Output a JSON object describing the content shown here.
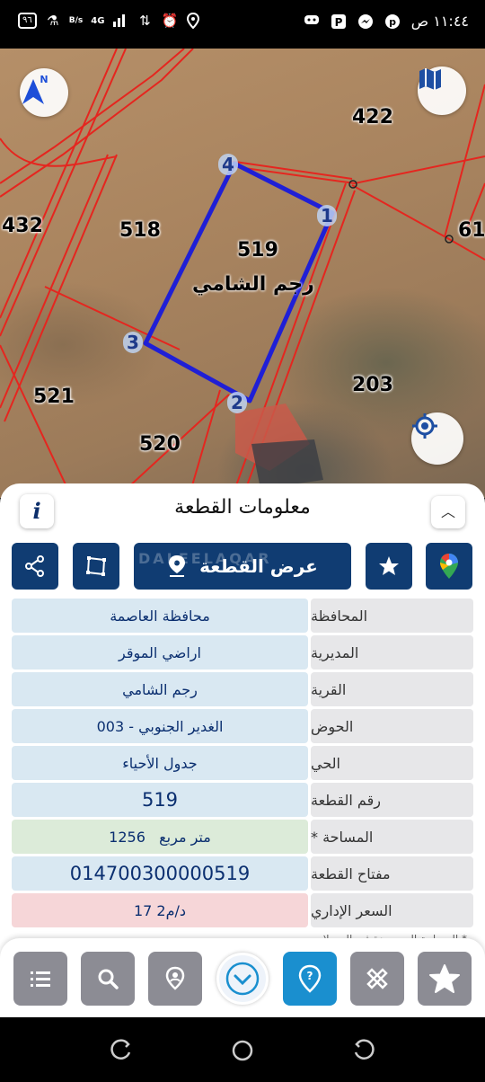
{
  "status_bar": {
    "battery": "٩٦",
    "net_speed": "B/s",
    "network": "4G",
    "time": "١١:٤٤ ص"
  },
  "map": {
    "parcels": [
      {
        "id": "p422",
        "label": "422"
      },
      {
        "id": "p432",
        "label": "432"
      },
      {
        "id": "p518",
        "label": "518"
      },
      {
        "id": "p519",
        "label": "519"
      },
      {
        "id": "p61",
        "label": "61"
      },
      {
        "id": "p521",
        "label": "521"
      },
      {
        "id": "p203",
        "label": "203"
      },
      {
        "id": "p520",
        "label": "520"
      }
    ],
    "village_name": "رجم الشامي",
    "vertices": [
      "1",
      "2",
      "3",
      "4"
    ],
    "north_label": "N",
    "colors": {
      "parcel_lines": "#e5261f",
      "selected_parcel": "#1f1fd6"
    }
  },
  "panel": {
    "title": "معلومات القطعة",
    "info_label": "i",
    "view_parcel_label": "عرض القطعة",
    "watermark": "DALEELAQAR",
    "rows": [
      {
        "key": "المحافظة",
        "value": "محافظة العاصمة"
      },
      {
        "key": "المديرية",
        "value": "اراضي الموقر"
      },
      {
        "key": "القرية",
        "value": "رجم الشامي"
      },
      {
        "key": "الحوض",
        "value": "الغدير الجنوبي - 003"
      },
      {
        "key": "الحي",
        "value": "جدول الأحياء"
      },
      {
        "key": "رقم القطعة",
        "value": "519"
      },
      {
        "key": "المساحة *",
        "value": "1256   متر مربع"
      },
      {
        "key": "مفتاح القطعة",
        "value": "014700300000519"
      },
      {
        "key": "السعر الإداري",
        "value": "17 د/م2"
      }
    ],
    "footnote": "* المساحة المرصودة في السجلات"
  },
  "colors": {
    "primary_dark": "#103c72",
    "accent_blue": "#1a8fcf",
    "toolbar_gray": "#8c8c94"
  }
}
